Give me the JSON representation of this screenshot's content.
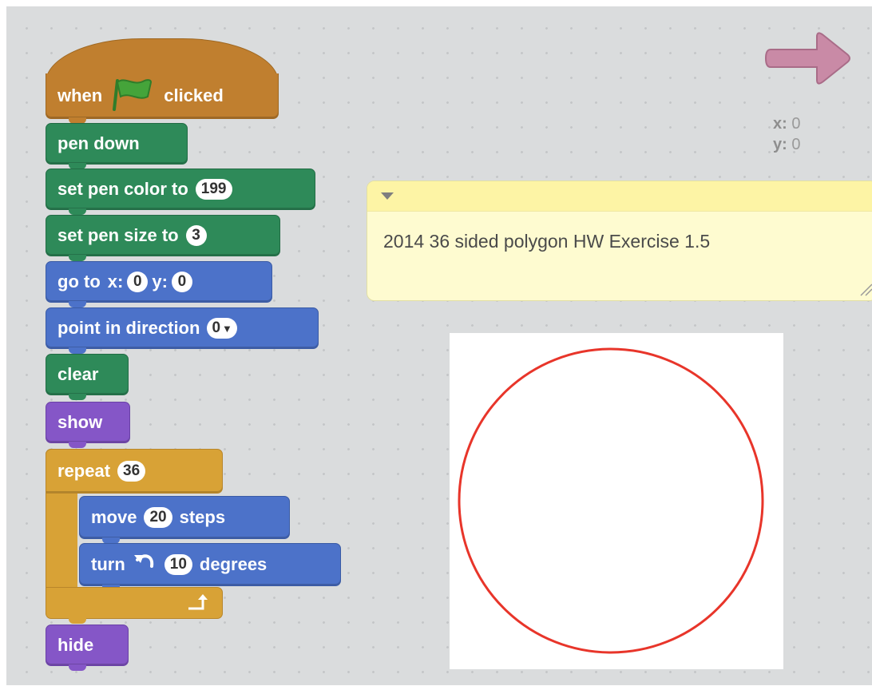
{
  "blocks": {
    "when_flag_clicked": {
      "when": "when",
      "clicked": "clicked"
    },
    "pen_down": "pen down",
    "set_pen_color": {
      "label": "set pen color to",
      "value": "199"
    },
    "set_pen_size": {
      "label": "set pen size to",
      "value": "3"
    },
    "go_to": {
      "label": "go to",
      "x_label": "x:",
      "x_value": "0",
      "y_label": "y:",
      "y_value": "0"
    },
    "point_in_direction": {
      "label": "point in direction",
      "value": "0"
    },
    "clear": "clear",
    "show": "show",
    "repeat": {
      "label": "repeat",
      "value": "36"
    },
    "move": {
      "label": "move",
      "value": "20",
      "suffix": "steps"
    },
    "turn": {
      "label": "turn",
      "value": "10",
      "suffix": "degrees"
    },
    "hide": "hide"
  },
  "sprite": {
    "x_label": "x:",
    "x_value": "0",
    "y_label": "y:",
    "y_value": "0"
  },
  "comment": {
    "text": "2014 36 sided polygon HW Exercise 1.5"
  },
  "colors": {
    "pen": "#2e8a59",
    "motion": "#4c72c9",
    "looks": "#8556c7",
    "control": "#d8a236",
    "events": "#c07f2f",
    "drawn_circle": "#e8352a",
    "sprite_arrow": "#c98aa6"
  },
  "icons": [
    "green-flag-icon",
    "turn-left-icon",
    "loop-arrow-icon",
    "dropdown-arrow-icon",
    "collapse-triangle-icon",
    "resize-grip-icon",
    "sprite-arrow-icon"
  ]
}
